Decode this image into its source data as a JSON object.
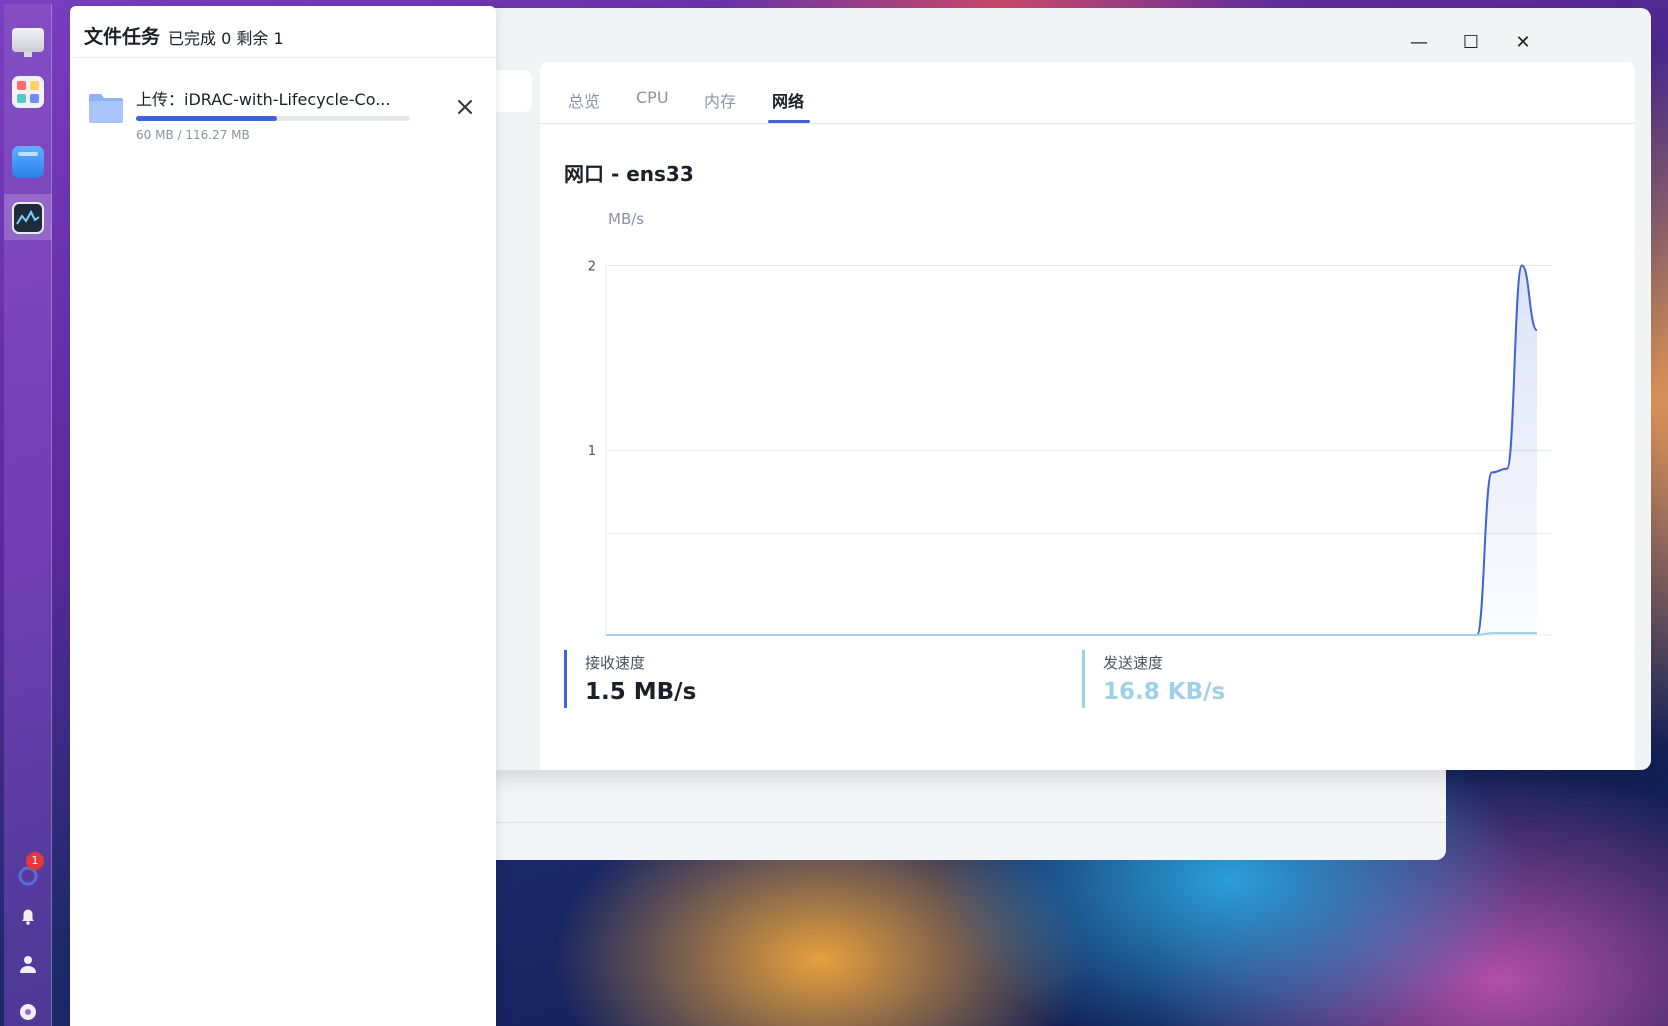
{
  "monitor": {
    "window_controls": {
      "minimize": "—",
      "maximize": "☐",
      "close": "✕"
    },
    "tabs": [
      {
        "label": "总览",
        "active": false
      },
      {
        "label": "CPU",
        "active": false
      },
      {
        "label": "内存",
        "active": false
      },
      {
        "label": "网络",
        "active": true
      }
    ],
    "interface_title": "网口 - ens33",
    "unit_label": "MB/s",
    "receive": {
      "label": "接收速度",
      "value": "1.5 MB/s",
      "color": "#3f63d8"
    },
    "send": {
      "label": "发送速度",
      "value": "16.8 KB/s",
      "color": "#9fd0e6"
    }
  },
  "tasks": {
    "title": "文件任务",
    "status": "已完成 0 剩余 1",
    "items": [
      {
        "name": "上传：iDRAC-with-Lifecycle-Co...",
        "size": "60 MB / 116.27 MB",
        "progress": 0.516,
        "icon": "folder-icon"
      }
    ]
  },
  "dock": {
    "notification_badge": "1",
    "icons": [
      "desktop-icon",
      "app-center-icon",
      "file-manager-icon",
      "resource-monitor-icon",
      "bell-icon",
      "user-icon",
      "gear-icon"
    ]
  },
  "chart_data": {
    "type": "area",
    "ylabel": "MB/s",
    "ylim": [
      0,
      2.1
    ],
    "yticks": [
      "1",
      "2"
    ],
    "grid": true,
    "series": [
      {
        "name": "接收速度",
        "color": "#3f63d8",
        "x": [
          0,
          58,
          59,
          60,
          61,
          62,
          63
        ],
        "values": [
          0,
          0,
          0.88,
          0.9,
          2.0,
          1.65,
          null
        ]
      },
      {
        "name": "发送速度",
        "color": "#9fd0e6",
        "x": [
          0,
          58,
          59,
          60,
          61,
          62,
          63
        ],
        "values": [
          0,
          0,
          0.01,
          0.01,
          0.01,
          0.01,
          null
        ]
      }
    ],
    "x_range": [
      0,
      63
    ]
  }
}
